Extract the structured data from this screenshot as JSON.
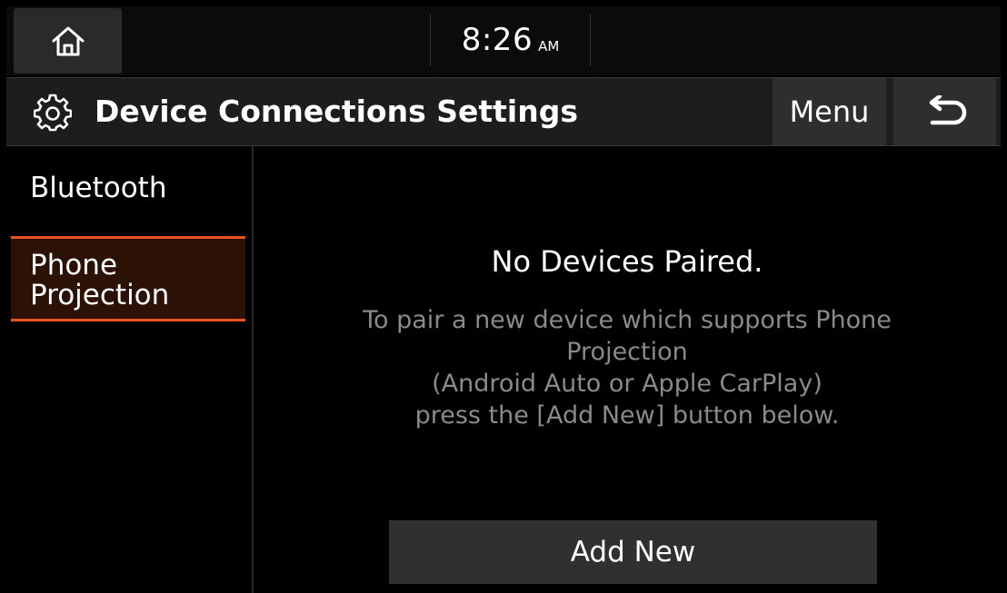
{
  "status": {
    "time": "8:26",
    "ampm": "AM"
  },
  "header": {
    "title": "Device Connections Settings",
    "menu_label": "Menu"
  },
  "sidebar": {
    "items": [
      {
        "label": "Bluetooth",
        "active": false
      },
      {
        "label": "Phone Projection",
        "active": true
      }
    ]
  },
  "main": {
    "empty_title": "No Devices Paired.",
    "description_lines": [
      "To pair a new device which supports Phone",
      "Projection",
      "(Android Auto or Apple CarPlay)",
      "press the [Add New] button below."
    ],
    "add_button_label": "Add New"
  },
  "colors": {
    "accent": "#e8531f",
    "active_bg": "#2c1206",
    "button_bg": "#303030",
    "muted_text": "#8a8a8a"
  },
  "icons": {
    "home": "home-icon",
    "settings": "gear-icon",
    "back": "back-arrow-icon"
  }
}
